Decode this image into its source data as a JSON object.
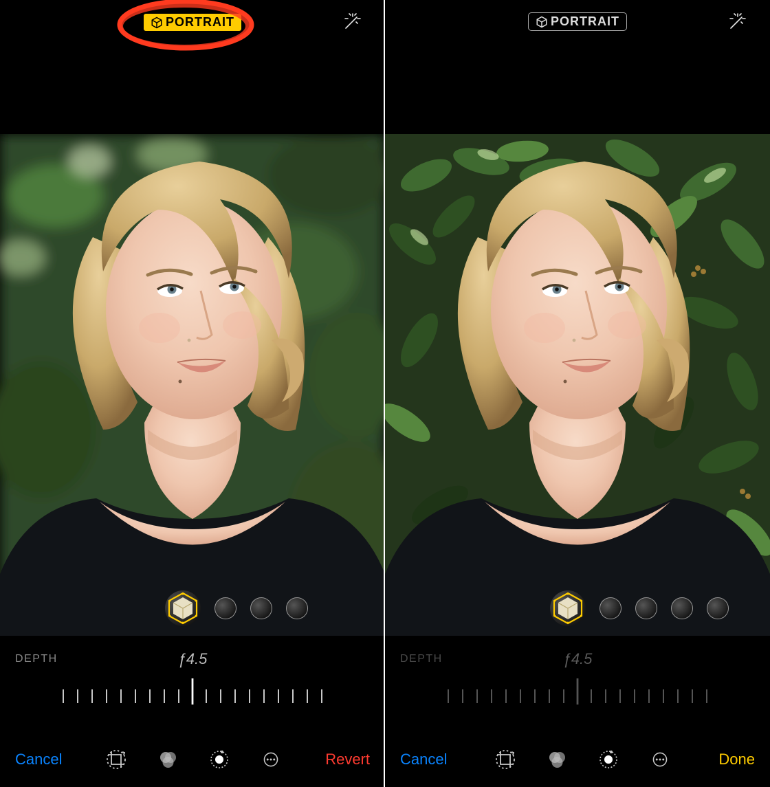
{
  "left": {
    "portrait_label": "PORTRAIT",
    "portrait_active": true,
    "depth_label": "DEPTH",
    "fstop": "ƒ4.5",
    "cancel": "Cancel",
    "action": "Revert",
    "lighting_options": [
      "natural",
      "studio",
      "contour",
      "stage"
    ],
    "lighting_selected": 0
  },
  "right": {
    "portrait_label": "PORTRAIT",
    "portrait_active": false,
    "depth_label": "DEPTH",
    "fstop": "ƒ4.5",
    "cancel": "Cancel",
    "action": "Done",
    "lighting_options": [
      "natural",
      "studio",
      "contour",
      "stage",
      "stage-mono"
    ],
    "lighting_selected": 0
  },
  "colors": {
    "accent_yellow": "#ffcc00",
    "ios_blue": "#0a84ff",
    "ios_red": "#ff3b30",
    "annotation": "#ff3b1f"
  }
}
